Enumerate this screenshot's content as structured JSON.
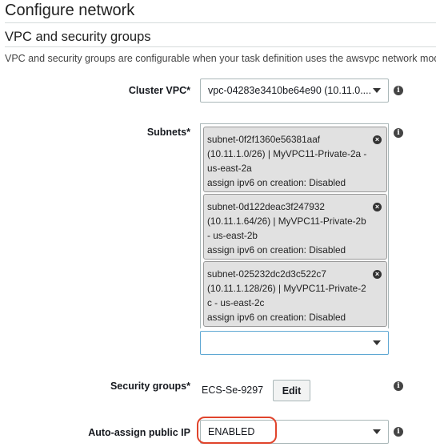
{
  "page": {
    "title": "Configure network"
  },
  "section": {
    "title": "VPC and security groups",
    "description": "VPC and security groups are configurable when your task definition uses the awsvpc network mode."
  },
  "cluster_vpc": {
    "label": "Cluster VPC*",
    "value": "vpc-04283e3410be64e90 (10.11.0...."
  },
  "subnets": {
    "label": "Subnets*",
    "items": [
      {
        "lines": [
          "subnet-0f2f1360e56381aaf",
          "(10.11.1.0/26) | MyVPC11-Private-2a -",
          "us-east-2a",
          "assign ipv6 on creation: Disabled"
        ]
      },
      {
        "lines": [
          "subnet-0d122deac3f247932",
          "(10.11.1.64/26) | MyVPC11-Private-2b",
          "- us-east-2b",
          "assign ipv6 on creation: Disabled"
        ]
      },
      {
        "lines": [
          "subnet-025232dc2d3c522c7",
          "(10.11.1.128/26) | MyVPC11-Private-2",
          "c - us-east-2c",
          "assign ipv6 on creation: Disabled"
        ]
      }
    ],
    "add_value": ""
  },
  "security_groups": {
    "label": "Security groups*",
    "value": "ECS-Se-9297",
    "edit_label": "Edit"
  },
  "auto_assign": {
    "label": "Auto-assign public IP",
    "value": "ENABLED"
  },
  "icons": {
    "info": "info-icon",
    "remove": "remove-chip-icon",
    "dropdown": "chevron-down-icon"
  },
  "colors": {
    "highlight": "#e0442c",
    "chip_bg": "#e1e1e1"
  }
}
